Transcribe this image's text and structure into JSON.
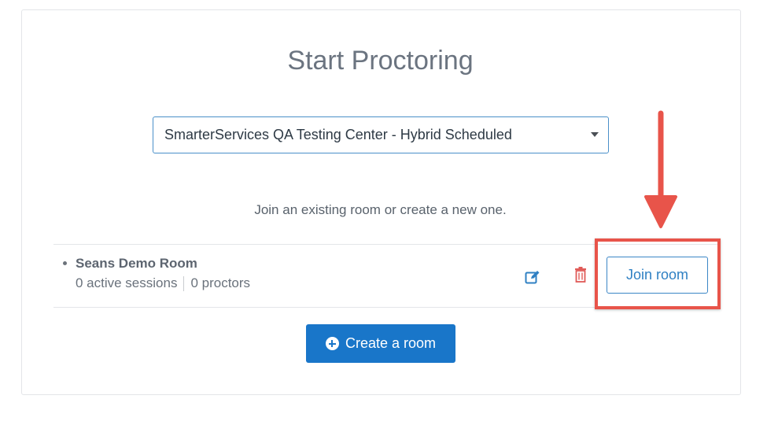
{
  "page": {
    "title": "Start Proctoring"
  },
  "center_select": {
    "selected": "SmarterServices QA Testing Center - Hybrid Scheduled"
  },
  "helper_text": "Join an existing room or create a new one.",
  "rooms": [
    {
      "name": "Seans Demo Room",
      "active_sessions": "0 active sessions",
      "proctors": "0 proctors",
      "join_label": "Join room"
    }
  ],
  "actions": {
    "create_label": "Create a room"
  },
  "icons": {
    "edit": "edit-icon",
    "delete": "trash-icon",
    "dropdown": "chevron-down-icon",
    "create": "plus-circle-icon",
    "annotation": "arrow-down-icon"
  },
  "colors": {
    "primary": "#1976c9",
    "link": "#2f80c3",
    "danger": "#e05a57",
    "annotation": "#e8544a",
    "title": "#6b7480"
  }
}
